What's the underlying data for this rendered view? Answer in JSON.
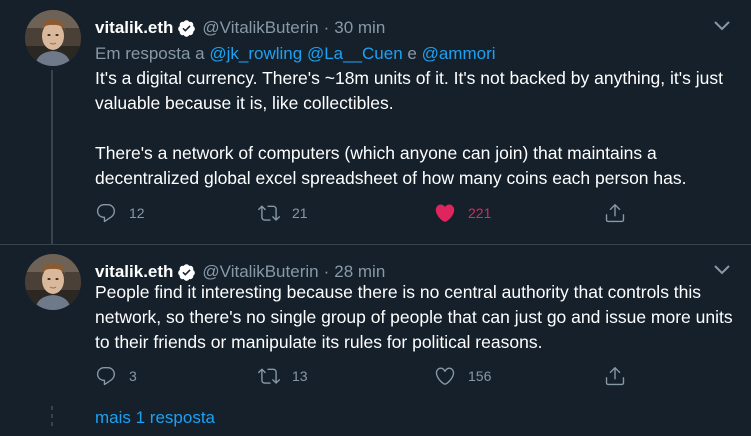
{
  "tweets": [
    {
      "name": "vitalik.eth",
      "handle": "@VitalikButerin",
      "separator": "·",
      "time": "30 min",
      "reply_to": {
        "prefix": "Em resposta a",
        "mention1": "@jk_rowling",
        "mention2": "@La__Cuen",
        "conj": "e",
        "mention3": "@ammori"
      },
      "paragraphs": [
        "It's a digital currency. There's ~18m units of it. It's not backed by anything, it's just valuable because it is, like collectibles.",
        "There's a network of computers (which anyone can join) that maintains a decentralized global excel spreadsheet of how many coins each person has."
      ],
      "replies": "12",
      "retweets": "21",
      "likes": "221",
      "liked": true
    },
    {
      "name": "vitalik.eth",
      "handle": "@VitalikButerin",
      "separator": "·",
      "time": "28 min",
      "paragraphs": [
        "People find it interesting because there is no central authority that controls this network, so there's no single group of people that can just go and issue more units to their friends or manipulate its rules for political reasons."
      ],
      "replies": "3",
      "retweets": "13",
      "likes": "156",
      "liked": false
    }
  ],
  "more_replies": "mais 1 resposta",
  "colors": {
    "background": "#15202b",
    "text": "#ffffff",
    "muted": "#8899a6",
    "link": "#1da1f2",
    "like": "#e0245e",
    "border": "#38444d"
  },
  "icons": {
    "verified": "verified-badge-icon",
    "caret": "chevron-down-icon",
    "reply": "reply-bubble-icon",
    "retweet": "retweet-icon",
    "like": "heart-icon",
    "share": "share-icon"
  }
}
